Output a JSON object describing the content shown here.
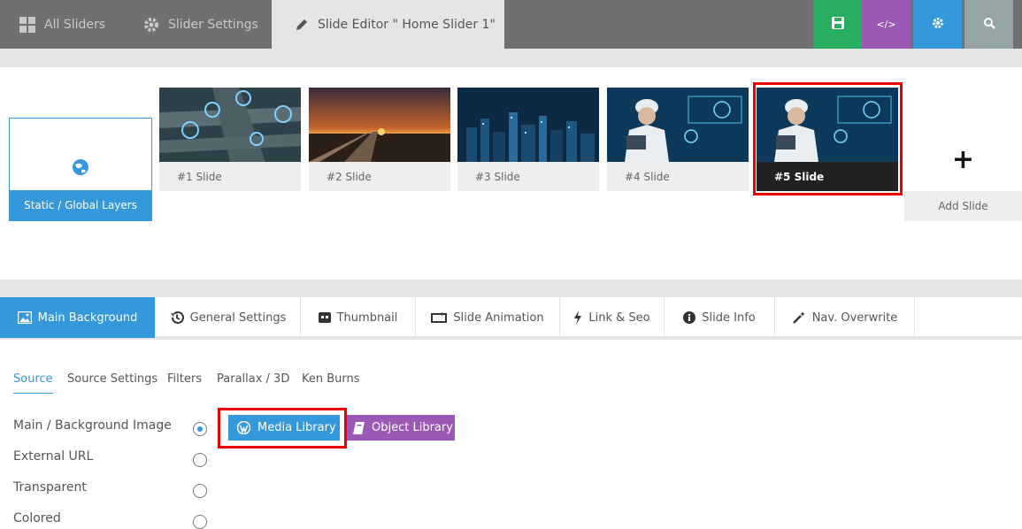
{
  "topbar": {
    "all_sliders": "All Sliders",
    "slider_settings": "Slider Settings",
    "slide_editor": "Slide Editor \" Home Slider 1\"",
    "code_label": "</>"
  },
  "slides": {
    "static_label": "Static / Global Layers",
    "items": [
      {
        "label": "#1 Slide"
      },
      {
        "label": "#2 Slide"
      },
      {
        "label": "#3 Slide"
      },
      {
        "label": "#4 Slide"
      },
      {
        "label": "#5 Slide"
      }
    ],
    "add_plus": "+",
    "add_label": "Add Slide"
  },
  "settings_tabs": [
    {
      "label": "Main Background"
    },
    {
      "label": "General Settings"
    },
    {
      "label": "Thumbnail"
    },
    {
      "label": "Slide Animation"
    },
    {
      "label": "Link & Seo"
    },
    {
      "label": "Slide Info"
    },
    {
      "label": "Nav. Overwrite"
    }
  ],
  "sub_tabs": [
    {
      "label": "Source"
    },
    {
      "label": "Source Settings"
    },
    {
      "label": "Filters"
    },
    {
      "label": "Parallax / 3D"
    },
    {
      "label": "Ken Burns"
    }
  ],
  "source_options": [
    {
      "label": "Main / Background Image",
      "selected": true
    },
    {
      "label": "External URL",
      "selected": false
    },
    {
      "label": "Transparent",
      "selected": false
    },
    {
      "label": "Colored",
      "selected": false
    }
  ],
  "buttons": {
    "media_library": "Media Library",
    "object_library": "Object Library"
  },
  "colors": {
    "accent": "#3498db",
    "save": "#27ae60",
    "code": "#9b59b6",
    "search": "#95a5a6",
    "highlight": "#e00000"
  }
}
